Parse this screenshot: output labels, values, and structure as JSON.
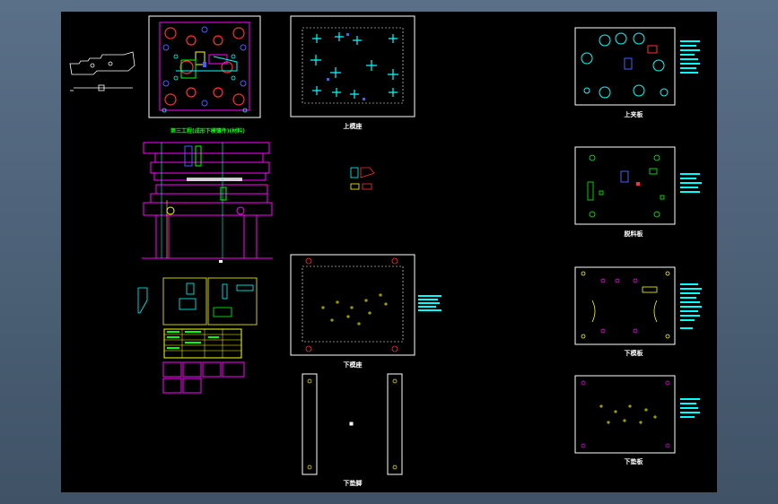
{
  "drawing": {
    "title_note": "第三工程(成形下模镶件)(材料)",
    "labels": {
      "upper_base": "上模座",
      "upper_backing_plate": "上夹板",
      "stripper_plate": "脱料板",
      "lower_die_plate": "下模板",
      "lower_base": "下模座",
      "lower_backing_plate": "下垫板",
      "lower_spacer": "下垫脚"
    }
  },
  "colors": {
    "background": "#000000",
    "frame": "#ffffff",
    "accent_cyan": "#00ffff",
    "accent_green": "#00ff00",
    "accent_magenta": "#ff00ff",
    "accent_red": "#ff3030",
    "accent_yellow": "#ffff00",
    "accent_blue": "#4060ff"
  }
}
